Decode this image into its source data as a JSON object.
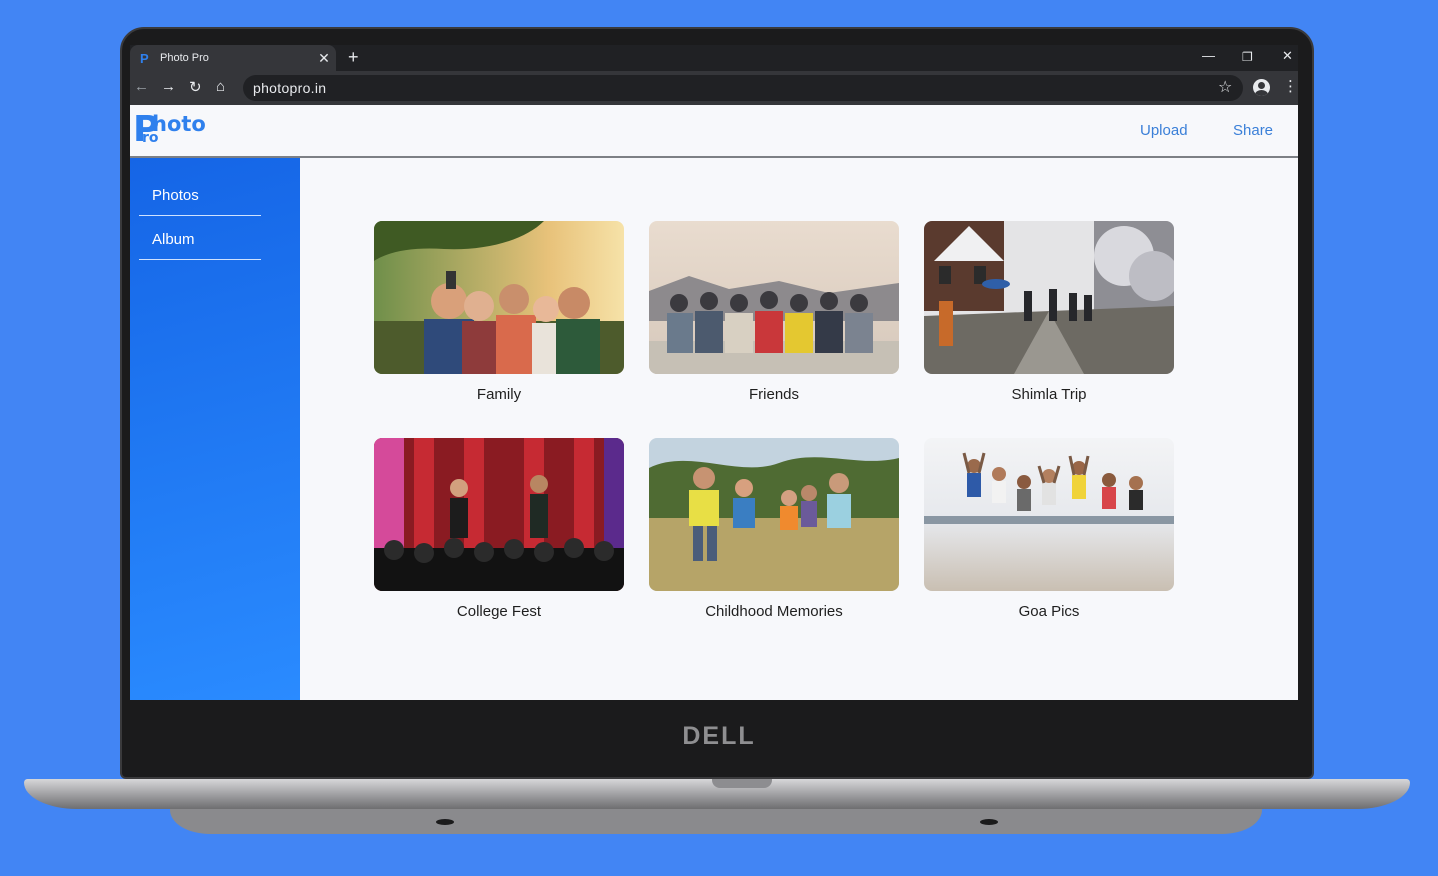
{
  "browser": {
    "tab_title": "Photo Pro",
    "tab_favicon": "P",
    "url": "photopro.in"
  },
  "app": {
    "logo": {
      "big": "P",
      "top": "hoto",
      "bottom": "ro"
    },
    "header": {
      "upload_label": "Upload",
      "share_label": "Share"
    },
    "sidebar": {
      "items": [
        {
          "label": "Photos"
        },
        {
          "label": "Album"
        }
      ]
    },
    "albums": [
      {
        "label": "Family"
      },
      {
        "label": "Friends"
      },
      {
        "label": "Shimla Trip"
      },
      {
        "label": "College Fest"
      },
      {
        "label": "Childhood Memories"
      },
      {
        "label": "Goa Pics"
      }
    ]
  },
  "device": {
    "brand": "DELL"
  },
  "colors": {
    "background": "#4285f4",
    "accent": "#2f80ed",
    "sidebar": "#1e78f5"
  },
  "icons": [
    "back-arrow-icon",
    "forward-arrow-icon",
    "reload-icon",
    "home-icon",
    "star-icon",
    "account-icon",
    "menu-dots-icon",
    "close-icon",
    "plus-icon",
    "minimize-icon",
    "restore-icon"
  ]
}
